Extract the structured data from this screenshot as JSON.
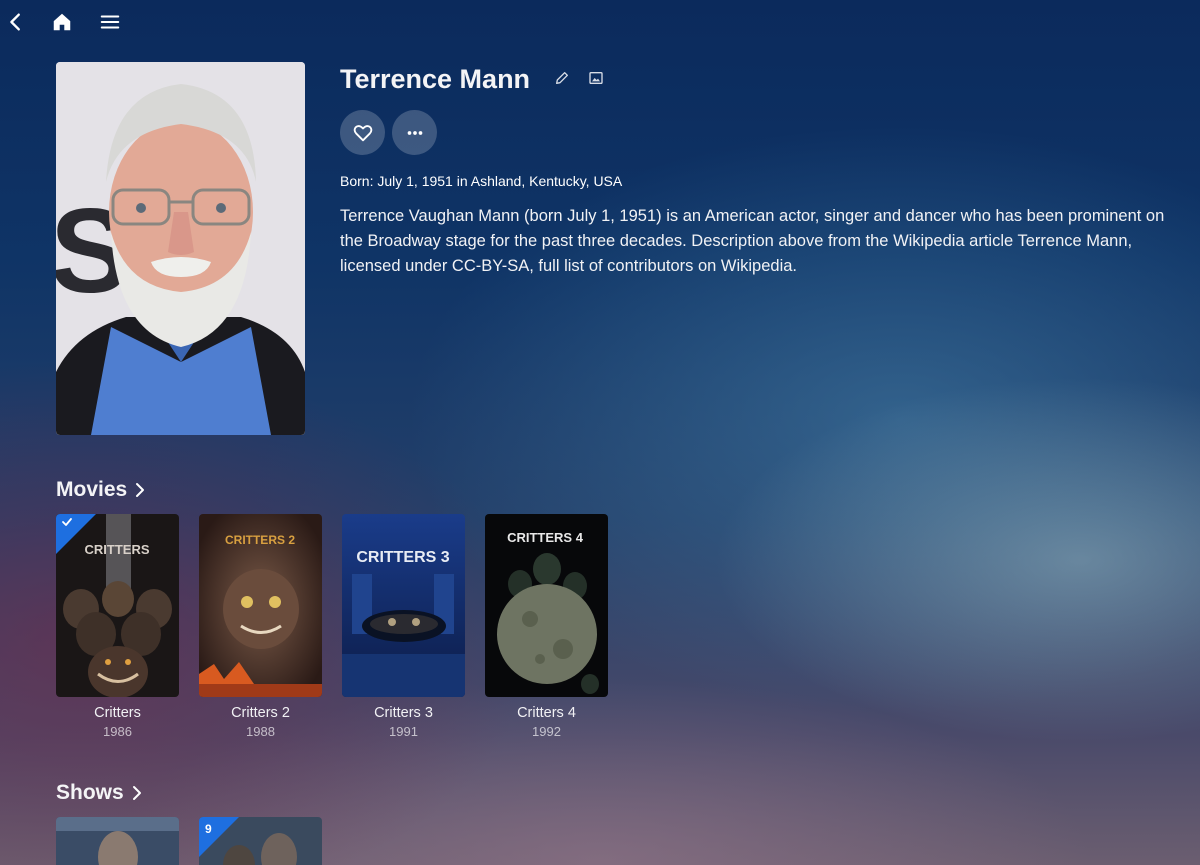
{
  "topbar": {
    "back_icon": "chevron-left-icon",
    "home_icon": "home-icon",
    "menu_icon": "hamburger-menu-icon"
  },
  "person": {
    "name": "Terrence Mann",
    "born": "Born: July 1, 1951 in Ashland, Kentucky, USA",
    "bio": "Terrence Vaughan Mann (born July 1, 1951) is an American actor, singer and dancer who has been prominent on the Broadway stage for the past three decades. Description above from the Wikipedia article Terrence Mann, licensed under CC-BY-SA, full list of contributors on Wikipedia."
  },
  "sections": {
    "movies_label": "Movies",
    "shows_label": "Shows"
  },
  "movies": [
    {
      "title": "Critters",
      "year": "1986",
      "poster_text": "CRITTERS",
      "watched": true
    },
    {
      "title": "Critters 2",
      "year": "1988",
      "poster_text": "CRITTERS 2",
      "watched": false
    },
    {
      "title": "Critters 3",
      "year": "1991",
      "poster_text": "CRITTERS 3",
      "watched": false
    },
    {
      "title": "Critters 4",
      "year": "1992",
      "poster_text": "CRITTERS 4",
      "watched": false
    }
  ],
  "shows": [
    {
      "badge": ""
    },
    {
      "badge": "9"
    }
  ],
  "colors": {
    "accent": "#1e6fe0",
    "button_bg": "rgba(255,255,255,0.2)"
  }
}
